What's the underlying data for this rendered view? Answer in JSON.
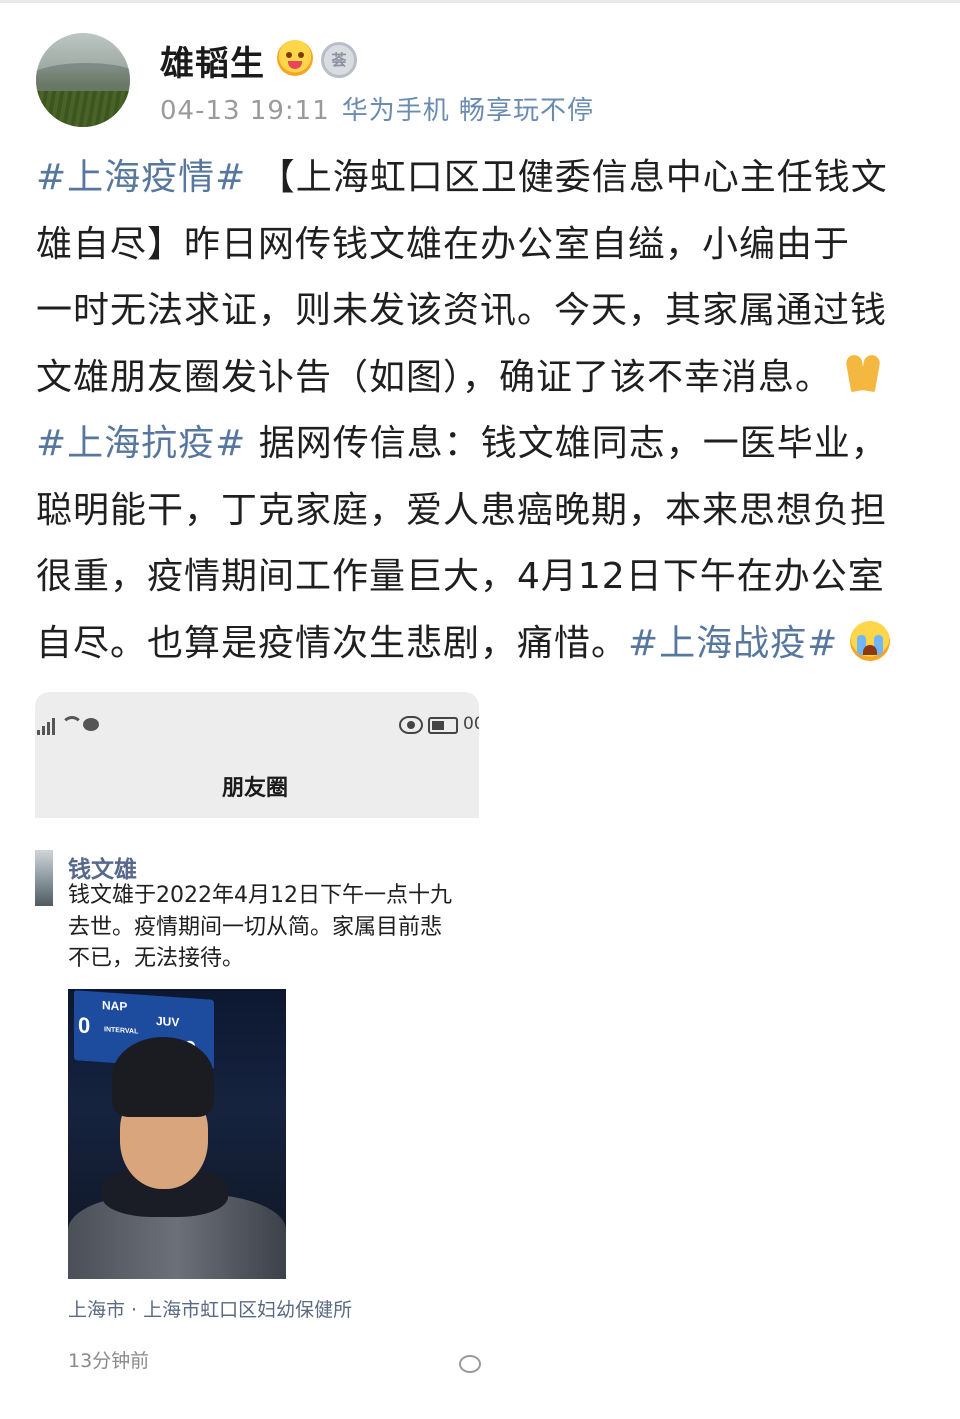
{
  "post": {
    "author": "雄韬生",
    "time": "04-13 19:11",
    "device": "华为手机 畅享玩不停",
    "lines": [
      [
        {
          "t": "#上海疫情#",
          "tag": true
        },
        {
          "t": " 【上海虹口区卫健委信息中心主任钱文"
        }
      ],
      [
        {
          "t": "雄自尽】昨日网传钱文雄在办公室自缢，小编由于"
        }
      ],
      [
        {
          "t": "一时无法求证，则未发该资讯。今天，其家属通过钱"
        }
      ],
      [
        {
          "t": "文雄朋友圈发讣告（如图），确证了该不幸消息。"
        },
        {
          "emoji": "pray"
        }
      ],
      [
        {
          "t": "#上海抗疫#",
          "tag": true
        },
        {
          "t": " 据网传信息：钱文雄同志，一医毕业，"
        }
      ],
      [
        {
          "t": "聪明能干，丁克家庭，爱人患癌晚期，本来思想负担"
        }
      ],
      [
        {
          "t": "很重，疫情期间工作量巨大，4月12日下午在办公室"
        }
      ],
      [
        {
          "t": "自尽。也算是疫情次生悲剧，痛惜。"
        },
        {
          "t": "#上海战疫#",
          "tag": true
        },
        {
          "emoji": "cry"
        }
      ]
    ]
  },
  "screenshot": {
    "battery_text": "00",
    "title": "朋友圈",
    "friend_name": "钱文雄",
    "friend_text": [
      "钱文雄于2022年4月12日下午一点十九",
      "去世。疫情期间一切从简。家属目前悲",
      "不已，无法接待。"
    ],
    "photo_scoreboard": {
      "left": "NAP",
      "right": "JUV",
      "score_left": "0",
      "score_right": "0",
      "label": "INTERVAL"
    },
    "location": "上海市 · 上海市虹口区妇幼保健所",
    "time_ago": "13分钟前"
  },
  "colors": {
    "tag": "#57779e",
    "text": "#1f1f1f",
    "meta": "#9a9a9a",
    "device": "#6b8bb1"
  }
}
